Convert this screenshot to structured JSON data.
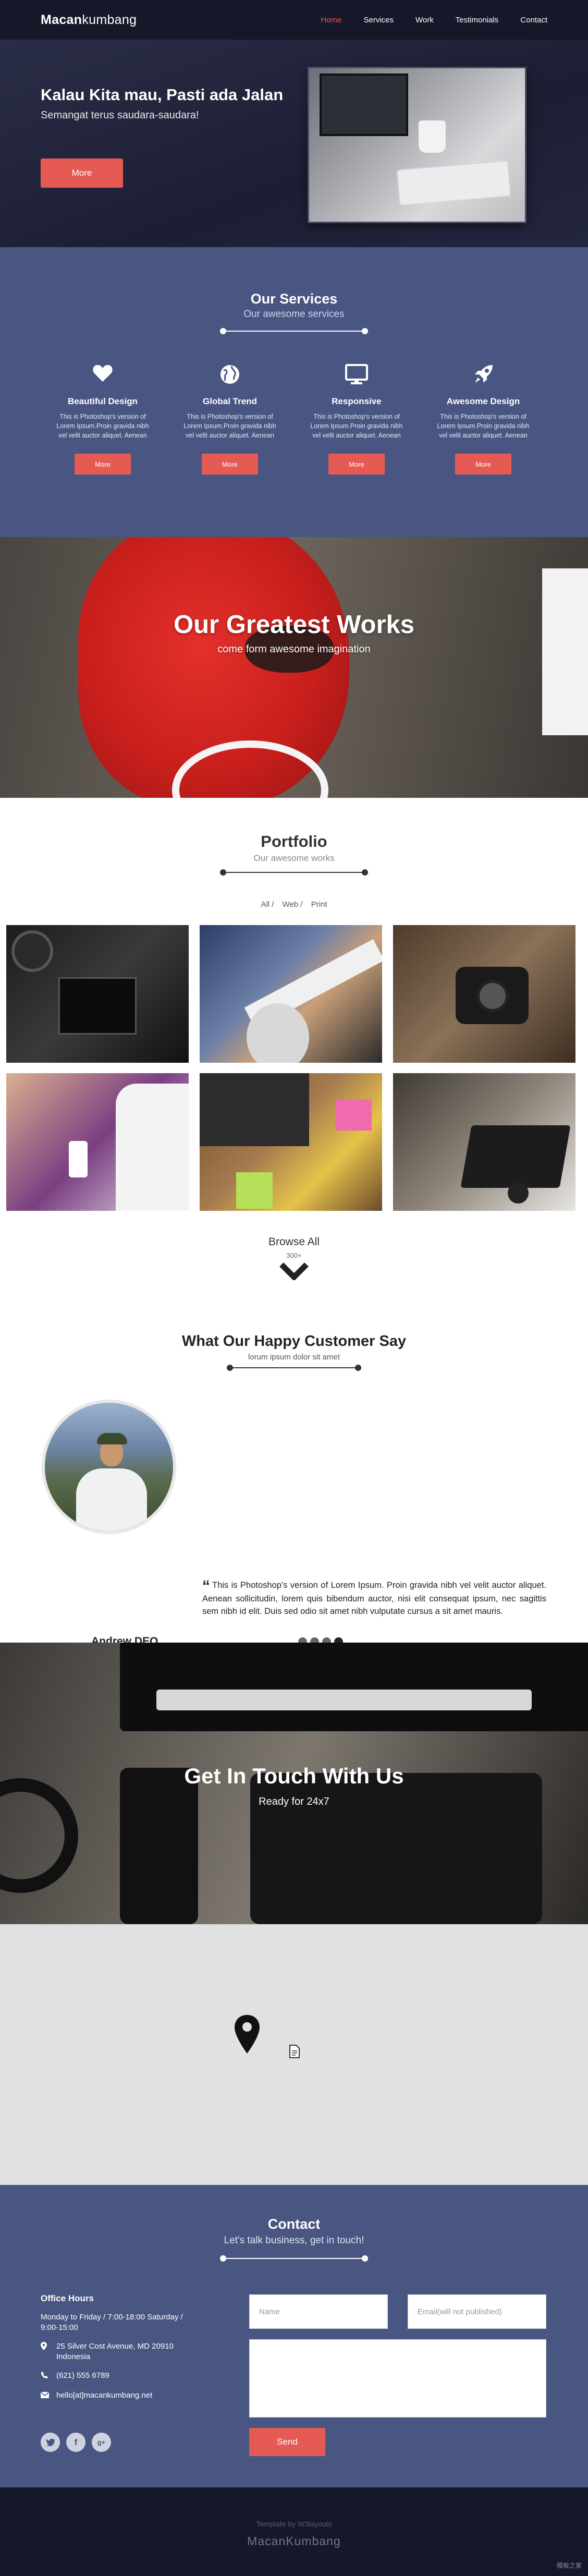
{
  "nav": {
    "brand_bold": "Macan",
    "brand_rest": "kumbang",
    "items": [
      "Home",
      "Services",
      "Work",
      "Testimonials",
      "Contact"
    ],
    "active_color": "#e65a54"
  },
  "hero": {
    "title": "Kalau Kita mau, Pasti ada Jalan",
    "subtitle": "Semangat terus saudara-saudara!",
    "button": "More"
  },
  "services": {
    "title": "Our Services",
    "subtitle": "Our awesome services",
    "items": [
      {
        "icon": "heart-icon",
        "title": "Beautiful Design",
        "text": "This is Photoshop's version of Lorem Ipsum.Proin gravida nibh vel velit auctor aliquet. Aenean",
        "button": "More"
      },
      {
        "icon": "globe-icon",
        "title": "Global Trend",
        "text": "This is Photoshop's version of Lorem Ipsum.Proin gravida nibh vel velit auctor aliquet. Aenean",
        "button": "More"
      },
      {
        "icon": "monitor-icon",
        "title": "Responsive",
        "text": "This is Photoshop's version of Lorem Ipsum.Proin gravida nibh vel velit auctor aliquet. Aenean",
        "button": "More"
      },
      {
        "icon": "rocket-icon",
        "title": "Awesome Design",
        "text": "This is Photoshop's version of Lorem Ipsum.Proin gravida nibh vel velit auctor aliquet. Aenean",
        "button": "More"
      }
    ],
    "bg_color": "#4a5682"
  },
  "works_banner": {
    "title": "Our Greatest Works",
    "subtitle": "come form awesome imagination"
  },
  "portfolio": {
    "title": "Portfolio",
    "subtitle": "Our awesome works",
    "filters": [
      "All /",
      "Web /",
      "Print"
    ],
    "browse_label": "Browse All",
    "browse_count": "300+"
  },
  "testimonial": {
    "title": "What Our Happy Customer Say",
    "subtitle": "lorum ipsum dolor sit amet",
    "quote": "This is Photoshop's version of Lorem Ipsum. Proin gravida nibh vel velit auctor aliquet. Aenean sollicitudin, lorem quis bibendum auctor, nisi elit consequat ipsum, nec sagittis sem nibh id elit. Duis sed odio sit amet nibh vulputate cursus a sit amet mauris.",
    "name": "Andrew DEO"
  },
  "touch_banner": {
    "title": "Get In Touch With Us",
    "subtitle": "Ready for 24x7"
  },
  "contact": {
    "title": "Contact",
    "subtitle": "Let's talk business, get in touch!",
    "office_title": "Office Hours",
    "hours": "Monday to Friday / 7:00-18:00 Saturday / 9:00-15:00",
    "address": "25 Silver Cost Avenue, MD 20910 Indonesia",
    "phone": "(621) 555 6789",
    "email": "hello[at]macankumbang.net",
    "name_placeholder": "Name",
    "email_placeholder": "Email(will not published)",
    "send_button": "Send",
    "social_icons": [
      "twitter-icon",
      "facebook-icon",
      "google-plus-icon"
    ]
  },
  "footer": {
    "credit": "Template by W3layouts",
    "brand": "MacanKumbang",
    "watermark": "模板之家"
  },
  "colors": {
    "dark": "#16182a",
    "accent": "#e65a54",
    "blue": "#4a5682"
  }
}
